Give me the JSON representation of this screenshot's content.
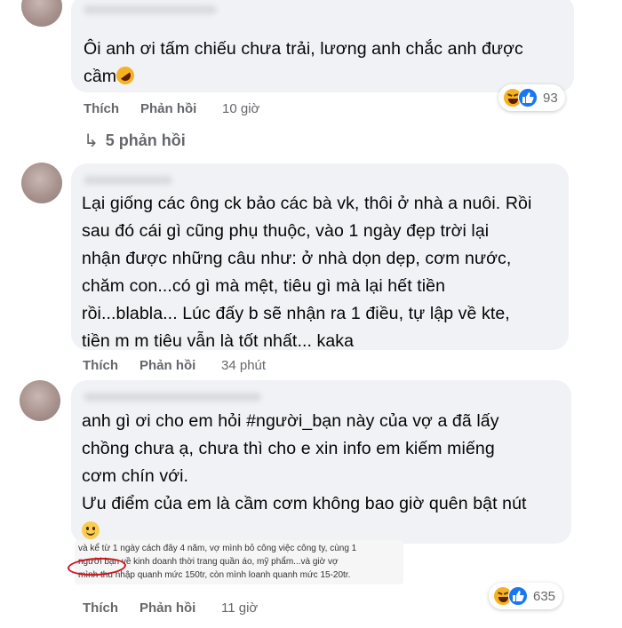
{
  "comments": [
    {
      "lines": [
        "Ôi anh ơi tấm chiếu chưa trải, lương anh chắc anh được",
        "cầm"
      ],
      "emoji": "rofl-emoji",
      "actions": {
        "like": "Thích",
        "reply": "Phản hồi",
        "time": "10 giờ"
      },
      "reactions": {
        "icons": [
          "haha-icon",
          "like-icon"
        ],
        "count": "93"
      },
      "replies_label": "5 phản hồi"
    },
    {
      "lines": [
        "Lại giống các ông ck bảo các bà vk, thôi ở nhà a nuôi. Rồi",
        "sau đó cái gì cũng phụ thuộc, vào 1 ngày đẹp trời lại",
        "nhận được những câu như: ở nhà dọn dẹp, cơm nước,",
        "chăm con...có gì mà mệt, tiêu gì mà lại hết tiền",
        "rồi...blabla... Lúc đấy b sẽ nhận ra 1 điều, tự lập về kte,",
        "tiền m m tiêu vẫn là tốt nhất... kaka"
      ],
      "actions": {
        "like": "Thích",
        "reply": "Phản hồi",
        "time": "34 phút"
      }
    },
    {
      "lines": [
        "anh gì ơi cho em hỏi #người_bạn này của vợ a đã lấy",
        "chồng chưa ạ, chưa thì cho e xin info em kiếm miếng",
        "cơm chín với.",
        "Ưu điểm của em là cầm cơm không bao giờ quên bật nút"
      ],
      "emoji": "smile-emoji",
      "embedded_lines": [
        "và kể từ 1 ngày cách đây 4 năm, vợ mình bỏ công việc công ty, cùng 1",
        "người bạn về kinh doanh thời trang quần áo, mỹ phẩm...và giờ vợ",
        "mình thu nhập quanh mức 150tr, còn mình loanh quanh mức 15-20tr."
      ],
      "actions": {
        "like": "Thích",
        "reply": "Phản hồi",
        "time": "11 giờ"
      },
      "reactions": {
        "icons": [
          "haha-icon",
          "like-icon"
        ],
        "count": "635"
      }
    }
  ]
}
